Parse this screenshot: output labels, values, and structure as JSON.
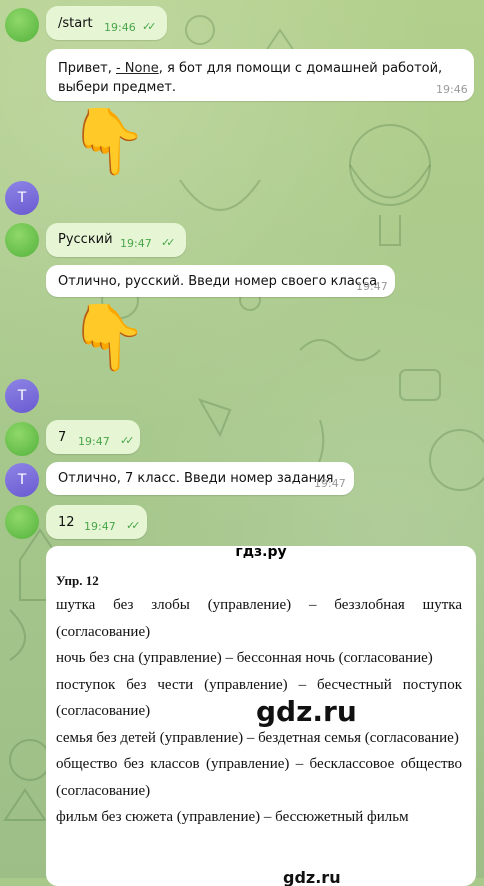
{
  "messages": {
    "m1": {
      "text": "/start",
      "time": "19:46"
    },
    "m2": {
      "text_before": "Привет, ",
      "link": "- None",
      "text_after": ", я бот для помощи с домашней работой, выбери предмет.",
      "time": "19:46"
    },
    "m3": {
      "emoji": "👇"
    },
    "m4": {
      "text": "Русский",
      "time": "19:47"
    },
    "m5": {
      "text": "Отлично, русский. Введи номер своего класса",
      "time": "19:47"
    },
    "m6": {
      "emoji": "👇"
    },
    "m7": {
      "text": "7",
      "time": "19:47"
    },
    "m8": {
      "text": "Отлично, 7 класс. Введи номер задания",
      "time": "19:47"
    },
    "m9": {
      "text": "12",
      "time": "19:47"
    }
  },
  "bot_avatar_letter": "T",
  "checks": "✓✓",
  "doc": {
    "site": "гдз.ру",
    "heading": "Упр. 12",
    "lines": [
      "шутка без злобы (управление) – беззлобная шутка (согласование)",
      "ночь без сна (управление) – бессонная ночь (согласование)",
      "поступок без чести (управление) – бесчестный поступок (согласование)",
      "семья без детей (управление) – бездетная семья (согласование)",
      "общество без классов (управление) – бесклассовое общество (согласование)",
      "фильм без сюжета (управление) – бессюжетный фильм"
    ],
    "watermark": "gdz.ru",
    "watermark_bottom": "gdz.ru"
  }
}
